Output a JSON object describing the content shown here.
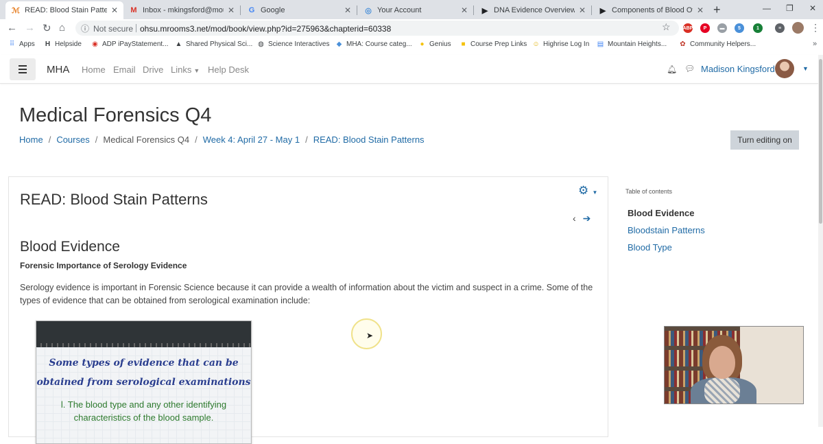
{
  "browser": {
    "tabs": [
      {
        "title": "READ: Blood Stain Patterns: F",
        "icon": "moodle-icon",
        "active": true
      },
      {
        "title": "Inbox - mkingsford@mount",
        "icon": "gmail-icon"
      },
      {
        "title": "Google",
        "icon": "google-icon"
      },
      {
        "title": "Your Account",
        "icon": "account-icon"
      },
      {
        "title": "DNA Evidence Overview",
        "icon": "play-icon"
      },
      {
        "title": "Components of Blood Overv",
        "icon": "play-icon"
      }
    ],
    "security": "Not secure",
    "url": "ohsu.mrooms3.net/mod/book/view.php?id=275963&chapterid=60338",
    "bookmarks": [
      {
        "label": "Apps",
        "icon": "apps-icon"
      },
      {
        "label": "Helpside",
        "icon": "helpside-icon"
      },
      {
        "label": "ADP iPayStatement...",
        "icon": "adp-icon"
      },
      {
        "label": "Shared Physical Sci...",
        "icon": "cap-icon"
      },
      {
        "label": "Science Interactives",
        "icon": "globe-icon"
      },
      {
        "label": "MHA: Course categ...",
        "icon": "drop-icon"
      },
      {
        "label": "Genius",
        "icon": "bulb-icon"
      },
      {
        "label": "Course Prep Links",
        "icon": "folder-icon"
      },
      {
        "label": "Highrise Log In",
        "icon": "smile-icon"
      },
      {
        "label": "Mountain Heights...",
        "icon": "doc-icon"
      },
      {
        "label": "Community Helpers...",
        "icon": "community-icon"
      }
    ],
    "more_bookmarks": "»"
  },
  "site": {
    "brand": "MHA",
    "nav": [
      "Home",
      "Email",
      "Drive",
      "Links",
      "Help Desk"
    ],
    "user_name": "Madison Kingsford"
  },
  "header": {
    "course_title": "Medical Forensics Q4",
    "breadcrumb": [
      "Home",
      "Courses",
      "Medical Forensics Q4",
      "Week 4: April 27 - May 1",
      "READ: Blood Stain Patterns"
    ],
    "edit_button": "Turn editing on"
  },
  "book": {
    "title": "READ: Blood Stain Patterns",
    "section_title": "Blood Evidence",
    "subsection_title": "Forensic Importance of Serology Evidence",
    "paragraph": "Serology evidence is important in Forensic Science because it can provide a wealth of information about the victim and suspect in a crime. Some of the types of evidence that can be obtained from serological examination include:",
    "image": {
      "heading": "Some types of evidence that can be obtained from serological examinations",
      "point_1": "l. The blood type and any other identifying characteristics of the blood sample."
    }
  },
  "toc": {
    "label": "Table of contents",
    "items": [
      "Blood Evidence",
      "Bloodstain Patterns",
      "Blood Type"
    ],
    "current_index": 0
  },
  "colors": {
    "link": "#1f6aa5",
    "edit_button_bg": "#ced4da",
    "tab_strip": "#dee1e6"
  }
}
